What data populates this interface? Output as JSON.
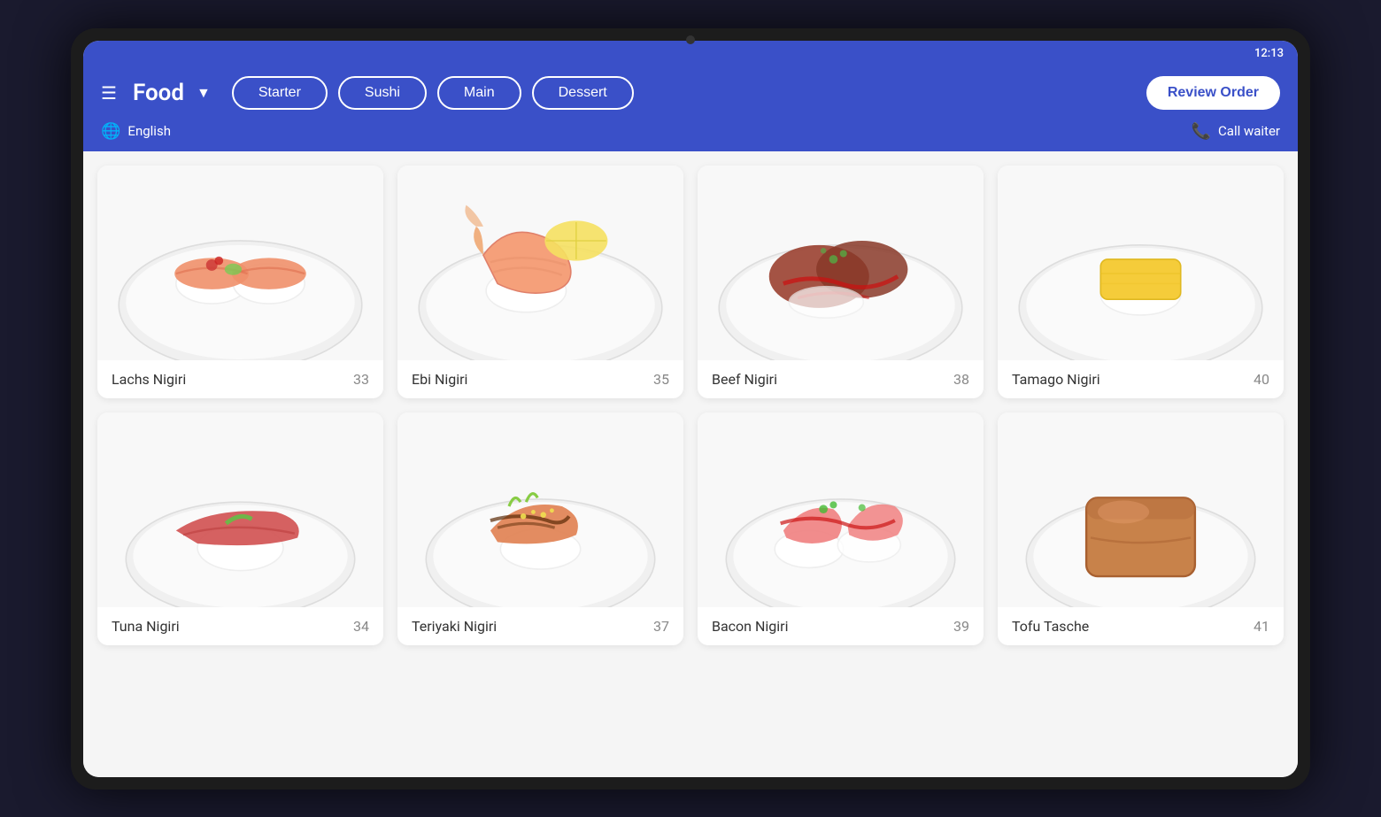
{
  "status_bar": {
    "time": "12:13"
  },
  "header": {
    "menu_icon": "☰",
    "title": "Food",
    "dropdown_icon": "▼",
    "review_order_label": "Review Order",
    "language_label": "English",
    "call_waiter_label": "Call waiter"
  },
  "categories": [
    {
      "id": "starter",
      "label": "Starter"
    },
    {
      "id": "sushi",
      "label": "Sushi"
    },
    {
      "id": "main",
      "label": "Main"
    },
    {
      "id": "dessert",
      "label": "Dessert"
    }
  ],
  "food_items": [
    {
      "id": 1,
      "name": "Lachs Nigiri",
      "number": "33",
      "emoji": "🍣",
      "color": "#f8a07a"
    },
    {
      "id": 2,
      "name": "Ebi Nigiri",
      "number": "35",
      "emoji": "🦐",
      "color": "#f0c08a"
    },
    {
      "id": 3,
      "name": "Beef Nigiri",
      "number": "38",
      "emoji": "🥩",
      "color": "#c0706a"
    },
    {
      "id": 4,
      "name": "Tamago Nigiri",
      "number": "40",
      "emoji": "🍱",
      "color": "#f5d080"
    },
    {
      "id": 5,
      "name": "Tuna Nigiri",
      "number": "34",
      "emoji": "🐟",
      "color": "#e87070"
    },
    {
      "id": 6,
      "name": "Teriyaki Nigiri",
      "number": "37",
      "emoji": "🍣",
      "color": "#c08060"
    },
    {
      "id": 7,
      "name": "Bacon Nigiri",
      "number": "39",
      "emoji": "🦞",
      "color": "#f09090"
    },
    {
      "id": 8,
      "name": "Tofu Tasche",
      "number": "41",
      "emoji": "🍘",
      "color": "#c8906a"
    }
  ],
  "colors": {
    "primary": "#3a50c8",
    "text_dark": "#333333",
    "text_light": "#888888"
  }
}
